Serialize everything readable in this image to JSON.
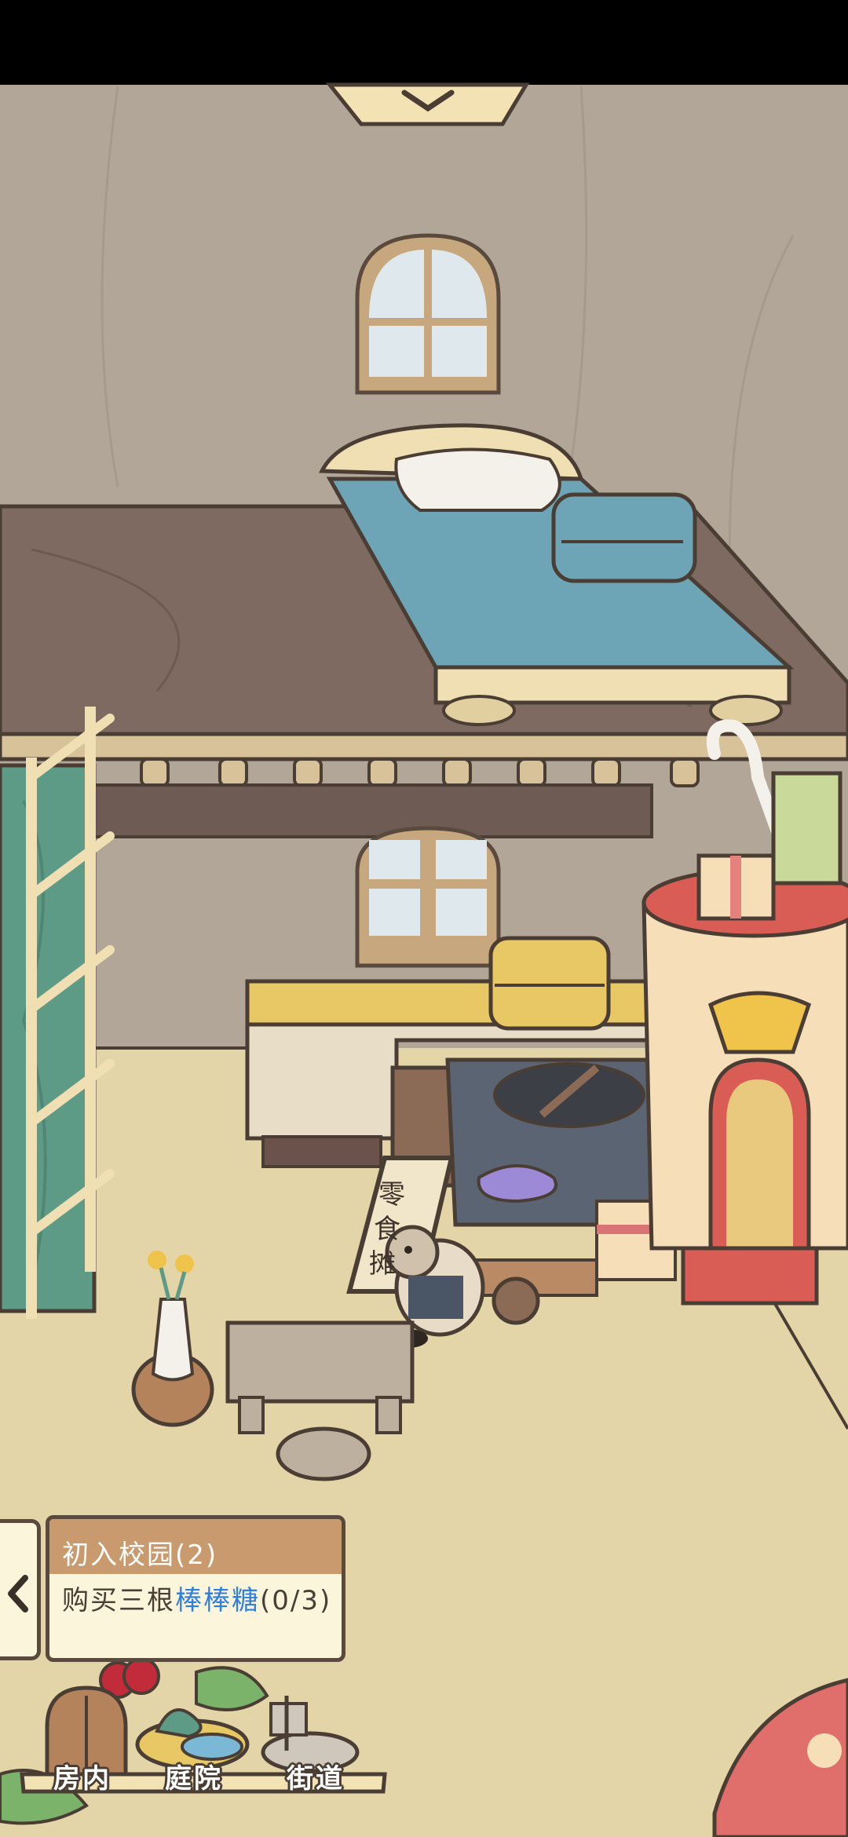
{
  "scene": {
    "snack_stall_sign": [
      "零",
      "食",
      "摊"
    ]
  },
  "quest": {
    "title": "初入校园(2)",
    "desc_prefix": "购买三根",
    "desc_highlight": "棒棒糖",
    "desc_suffix": "(0/3)",
    "highlight_color": "#2f7fe0"
  },
  "bottom_nav": {
    "items": [
      {
        "label": "房内",
        "icon": "door-icon"
      },
      {
        "label": "庭院",
        "icon": "garden-icon"
      },
      {
        "label": "街道",
        "icon": "street-icon"
      }
    ]
  }
}
